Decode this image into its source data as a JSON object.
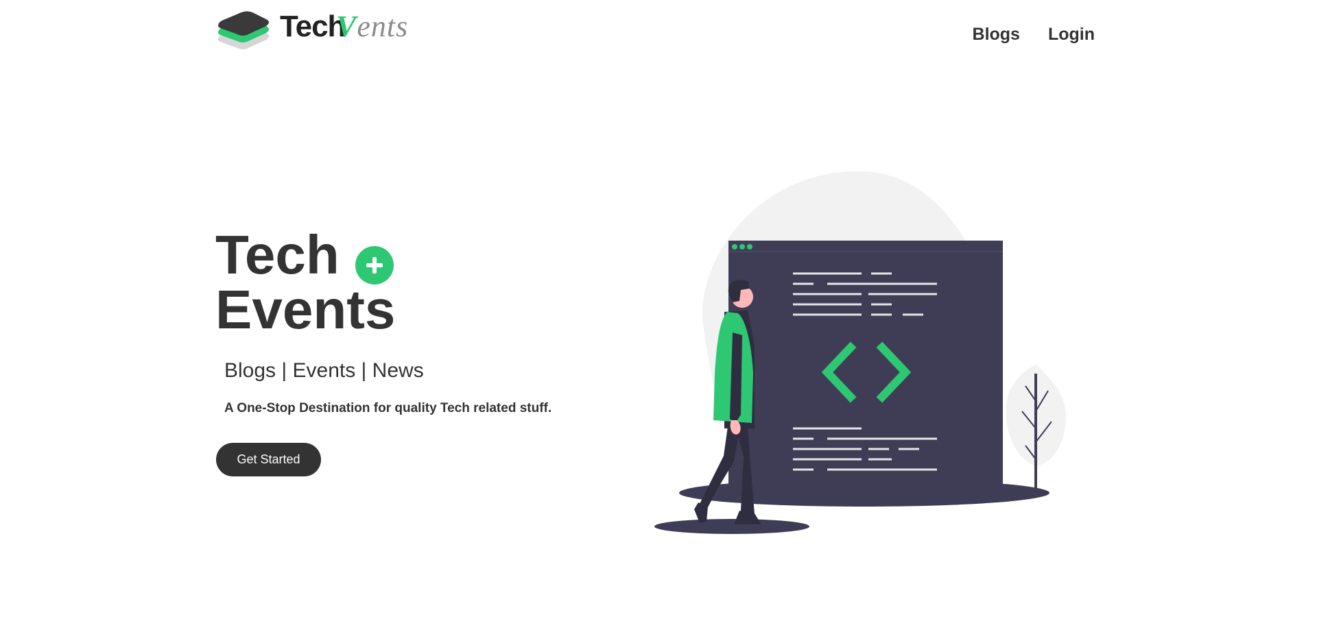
{
  "brand": {
    "name_part1": "Tech",
    "name_part2_v": "V",
    "name_part2_rest": "ents",
    "accent_color": "#2ec772",
    "dark_color": "#333333"
  },
  "nav": {
    "items": [
      {
        "label": "Blogs"
      },
      {
        "label": "Login"
      }
    ]
  },
  "hero": {
    "title_line1": "Tech",
    "title_line2": "Events",
    "badge_icon": "plus-icon",
    "tagline": "Blogs | Events | News",
    "description": "A One-Stop Destination for quality Tech related stuff.",
    "cta_label": "Get Started"
  },
  "illustration": {
    "icon": "code-brackets-icon",
    "subject": "person-walking",
    "window_bg": "#3f3d56",
    "blob_bg": "#f2f2f2"
  }
}
